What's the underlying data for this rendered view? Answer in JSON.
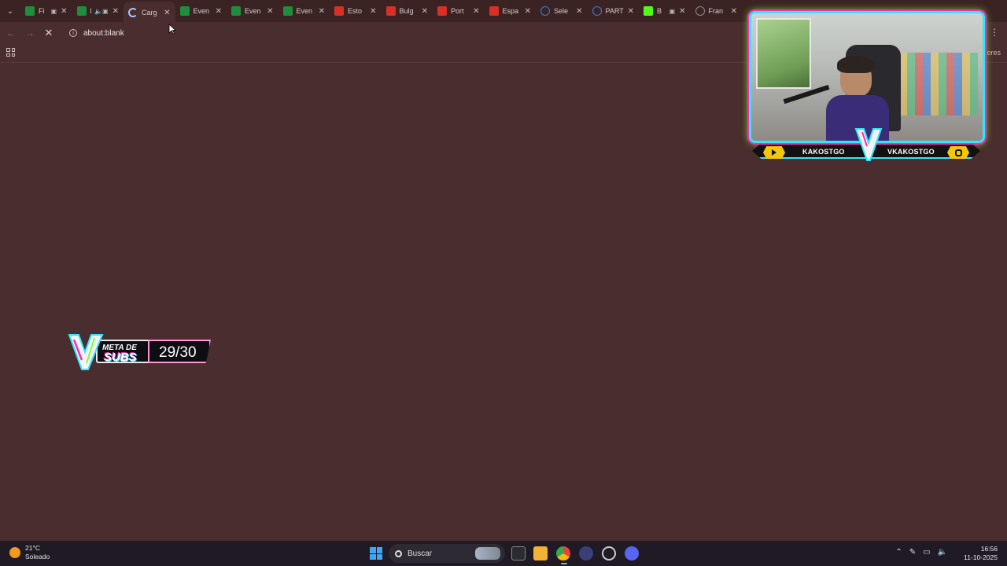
{
  "browser": {
    "tabs": [
      {
        "title": "Fi",
        "favicon": "sheets-icon",
        "fav_color": "#1e8e3e",
        "extra": "▣"
      },
      {
        "title": "E",
        "favicon": "sheets-icon",
        "fav_color": "#1e8e3e",
        "extra": "🔈▣"
      },
      {
        "title": "Carg",
        "favicon": "loading-icon",
        "fav_color": "",
        "extra": "",
        "active": true
      },
      {
        "title": "Even",
        "favicon": "sheets-icon",
        "fav_color": "#1e8e3e",
        "extra": ""
      },
      {
        "title": "Even",
        "favicon": "sheets-icon",
        "fav_color": "#1e8e3e",
        "extra": ""
      },
      {
        "title": "Even",
        "favicon": "sheets-icon",
        "fav_color": "#1e8e3e",
        "extra": ""
      },
      {
        "title": "Esto",
        "favicon": "red-b-icon",
        "fav_color": "#d93025",
        "extra": ""
      },
      {
        "title": "Bulg",
        "favicon": "red-b-icon",
        "fav_color": "#d93025",
        "extra": ""
      },
      {
        "title": "Port",
        "favicon": "red-b-icon",
        "fav_color": "#d93025",
        "extra": ""
      },
      {
        "title": "Espa",
        "favicon": "red-b-icon",
        "fav_color": "#d93025",
        "extra": ""
      },
      {
        "title": "Sele",
        "favicon": "globe-icon",
        "fav_color": "#3c7bd9",
        "extra": ""
      },
      {
        "title": "PART",
        "favicon": "globe-icon",
        "fav_color": "#3c7bd9",
        "extra": ""
      },
      {
        "title": "B",
        "favicon": "kick-icon",
        "fav_color": "#53fc18",
        "extra": "▣"
      },
      {
        "title": "Fran",
        "favicon": "globe-icon",
        "fav_color": "#8a8a8a",
        "extra": ""
      }
    ],
    "address": "about:blank",
    "bookmarks_tail": "dores"
  },
  "overlay": {
    "cam_left_name": "KAKOSTGO",
    "cam_right_name": "VKAKOSTGO",
    "subs_label_top": "META DE",
    "subs_label_bottom": "SUBS",
    "subs_count": "29/30",
    "subs_current": 29,
    "subs_goal": 30
  },
  "taskbar": {
    "weather_temp": "21°C",
    "weather_desc": "Soleado",
    "search_placeholder": "Buscar",
    "time": "16:56",
    "date": "11-10-2025"
  },
  "colors": {
    "page_bg": "#4a2d2e",
    "tabstrip_bg": "#3b2324",
    "taskbar_bg": "#1f1a24",
    "neon_cyan": "#2ee6ff",
    "neon_pink": "#ff2ab0",
    "neon_green": "#7cff3a",
    "accent_yellow": "#f5c60a"
  }
}
